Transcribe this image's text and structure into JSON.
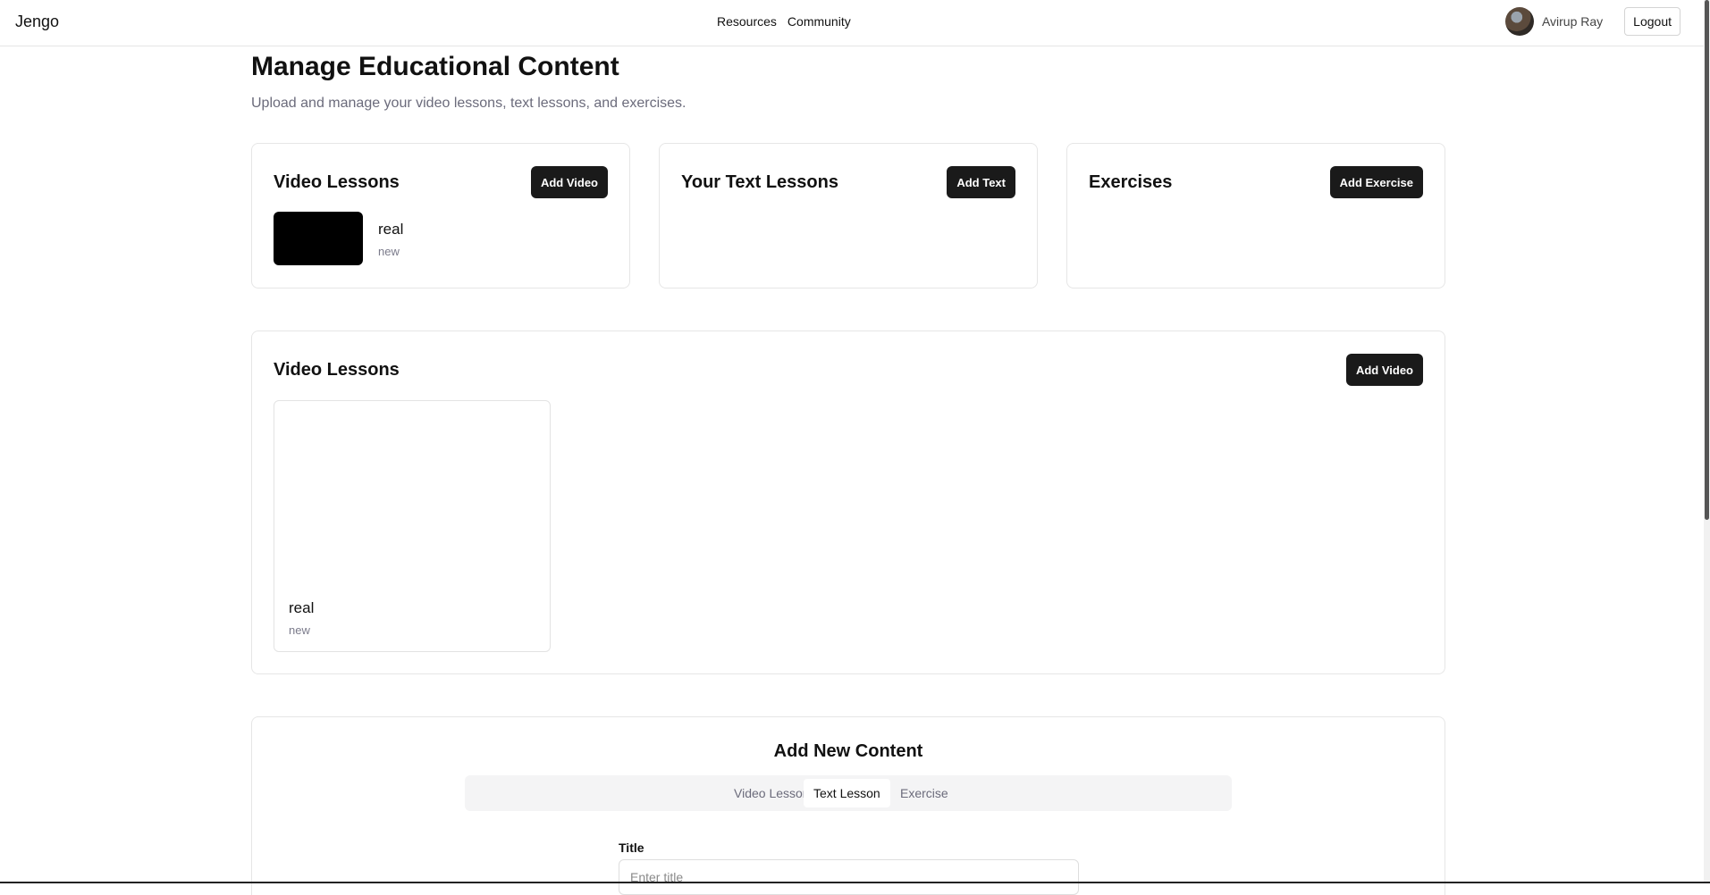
{
  "navbar": {
    "brand": "Jengo",
    "links": [
      "Resources",
      "Community"
    ],
    "user_name": "Avirup Ray",
    "logout_label": "Logout"
  },
  "page": {
    "title": "Manage Educational Content",
    "subtitle": "Upload and manage your video lessons, text lessons, and exercises."
  },
  "summary_cards": {
    "video": {
      "title": "Video Lessons",
      "button": "Add Video",
      "items": [
        {
          "title": "real",
          "subtitle": "new"
        }
      ]
    },
    "text": {
      "title": "Your Text Lessons",
      "button": "Add Text"
    },
    "exercise": {
      "title": "Exercises",
      "button": "Add Exercise"
    }
  },
  "video_section": {
    "title": "Video Lessons",
    "button": "Add Video",
    "items": [
      {
        "title": "real",
        "subtitle": "new"
      }
    ]
  },
  "add_content": {
    "title": "Add New Content",
    "tabs": [
      "Video Lesson",
      "Text Lesson",
      "Exercise"
    ],
    "active_tab": "Text Lesson",
    "title_label": "Title",
    "title_placeholder": "Enter title",
    "title_value": ""
  },
  "colors": {
    "primary_button": "#1a1a1a",
    "muted_text": "#6b6b7b",
    "border": "#e6e6e6",
    "tab_bar": "#f4f4f5"
  }
}
